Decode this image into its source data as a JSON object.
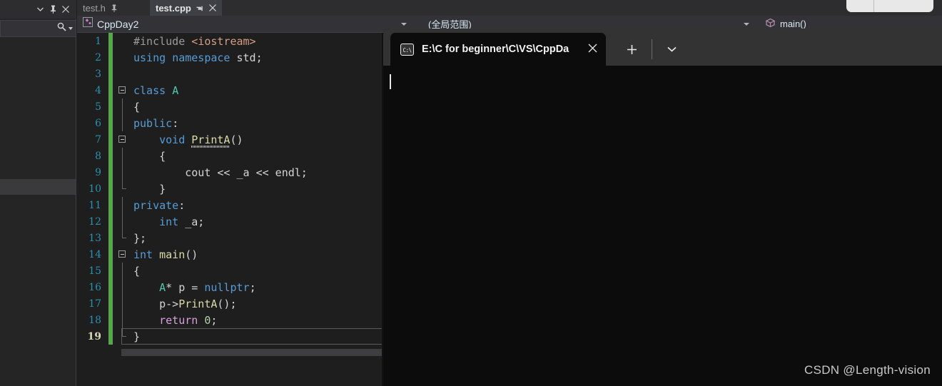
{
  "left_panel": {
    "header_icons": [
      "chevron-down-icon",
      "pin-icon",
      "close-icon"
    ],
    "search": {
      "value": "",
      "placeholder": "",
      "icon": "search-icon",
      "dropdown_icon": "chevron-down-icon"
    },
    "rows": [
      "",
      "",
      "",
      "",
      "",
      "",
      "",
      "",
      "",
      ""
    ],
    "selected_row_index": 9
  },
  "tabs": [
    {
      "label": "test.h",
      "active": false,
      "pin_icon": "pin-icon",
      "close_icon": ""
    },
    {
      "label": "test.cpp",
      "active": true,
      "pin_icon": "pin-icon",
      "close_icon": "✕"
    }
  ],
  "navbar": {
    "project": {
      "label": "CppDay2",
      "icon": "cpp-project-icon"
    },
    "scope": {
      "label": "(全局范围)"
    },
    "member": {
      "label": "main()",
      "icon": "method-cube-icon"
    }
  },
  "editor": {
    "language": "cpp",
    "current_line": 19,
    "lines": [
      {
        "n": 1,
        "fold": "none",
        "tokens": [
          {
            "t": "#include ",
            "c": "pp"
          },
          {
            "t": "<iostream>",
            "c": "str"
          }
        ]
      },
      {
        "n": 2,
        "fold": "none",
        "tokens": [
          {
            "t": "using",
            "c": "k"
          },
          {
            "t": " ",
            "c": "pl"
          },
          {
            "t": "namespace",
            "c": "k"
          },
          {
            "t": " std;",
            "c": "pl"
          }
        ]
      },
      {
        "n": 3,
        "fold": "none",
        "tokens": []
      },
      {
        "n": 4,
        "fold": "box",
        "tokens": [
          {
            "t": "class",
            "c": "k"
          },
          {
            "t": " ",
            "c": "pl"
          },
          {
            "t": "A",
            "c": "ty"
          }
        ]
      },
      {
        "n": 5,
        "fold": "line",
        "tokens": [
          {
            "t": "{",
            "c": "pl"
          }
        ]
      },
      {
        "n": 6,
        "fold": "line",
        "tokens": [
          {
            "t": "public",
            "c": "k"
          },
          {
            "t": ":",
            "c": "pl"
          }
        ]
      },
      {
        "n": 7,
        "fold": "box-inner",
        "tokens": [
          {
            "t": "    ",
            "c": "pl"
          },
          {
            "t": "void",
            "c": "k"
          },
          {
            "t": " ",
            "c": "pl"
          },
          {
            "t": "PrintA",
            "c": "fn sq"
          },
          {
            "t": "()",
            "c": "pl"
          }
        ]
      },
      {
        "n": 8,
        "fold": "line2",
        "tokens": [
          {
            "t": "    {",
            "c": "pl"
          }
        ]
      },
      {
        "n": 9,
        "fold": "line2",
        "tokens": [
          {
            "t": "        cout ",
            "c": "pl"
          },
          {
            "t": "<<",
            "c": "pl"
          },
          {
            "t": " _a ",
            "c": "pl"
          },
          {
            "t": "<<",
            "c": "pl"
          },
          {
            "t": " endl;",
            "c": "pl"
          }
        ]
      },
      {
        "n": 10,
        "fold": "end2",
        "tokens": [
          {
            "t": "    }",
            "c": "pl"
          }
        ]
      },
      {
        "n": 11,
        "fold": "line",
        "tokens": [
          {
            "t": "private",
            "c": "k"
          },
          {
            "t": ":",
            "c": "pl"
          }
        ]
      },
      {
        "n": 12,
        "fold": "line2",
        "tokens": [
          {
            "t": "    ",
            "c": "pl"
          },
          {
            "t": "int",
            "c": "k"
          },
          {
            "t": " _a;",
            "c": "pl"
          }
        ]
      },
      {
        "n": 13,
        "fold": "end",
        "tokens": [
          {
            "t": "};",
            "c": "pl"
          }
        ]
      },
      {
        "n": 14,
        "fold": "box",
        "tokens": [
          {
            "t": "int",
            "c": "k"
          },
          {
            "t": " ",
            "c": "pl"
          },
          {
            "t": "main",
            "c": "fn"
          },
          {
            "t": "()",
            "c": "pl"
          }
        ]
      },
      {
        "n": 15,
        "fold": "line",
        "tokens": [
          {
            "t": "{",
            "c": "pl"
          }
        ]
      },
      {
        "n": 16,
        "fold": "line2",
        "tokens": [
          {
            "t": "    ",
            "c": "pl"
          },
          {
            "t": "A",
            "c": "ty"
          },
          {
            "t": "* p = ",
            "c": "pl"
          },
          {
            "t": "nullptr",
            "c": "k"
          },
          {
            "t": ";",
            "c": "pl"
          }
        ]
      },
      {
        "n": 17,
        "fold": "line2",
        "tokens": [
          {
            "t": "    p->",
            "c": "pl"
          },
          {
            "t": "PrintA",
            "c": "fn"
          },
          {
            "t": "();",
            "c": "pl"
          }
        ]
      },
      {
        "n": 18,
        "fold": "line2",
        "tokens": [
          {
            "t": "    ",
            "c": "pl"
          },
          {
            "t": "return",
            "c": "kp"
          },
          {
            "t": " ",
            "c": "pl"
          },
          {
            "t": "0",
            "c": "num"
          },
          {
            "t": ";",
            "c": "pl"
          }
        ]
      },
      {
        "n": 19,
        "fold": "end",
        "tokens": [
          {
            "t": "}",
            "c": "pl"
          }
        ]
      }
    ]
  },
  "terminal": {
    "tab": {
      "title": "E:\\C for beginner\\C\\VS\\CppDa",
      "icon": "cmd-prompt-icon",
      "close_icon": "✕"
    },
    "new_tab_icon": "+",
    "dropdown_icon": "∨",
    "content": "",
    "caret_visible": true
  },
  "watermark": {
    "text": "CSDN @Length-vision"
  },
  "colors": {
    "vs_background": "#1e1e1e",
    "vs_chrome": "#2d2d30",
    "active_tab": "#3f3f46",
    "terminal_background": "#0c0c0c",
    "terminal_titlebar": "#333333",
    "saved_change_marker": "#57a64a",
    "keyword": "#569cd6",
    "type": "#4ec9b0",
    "function": "#dcdcaa",
    "string": "#d69d85",
    "number": "#b5cea8",
    "return_keyword": "#d8a0df"
  }
}
